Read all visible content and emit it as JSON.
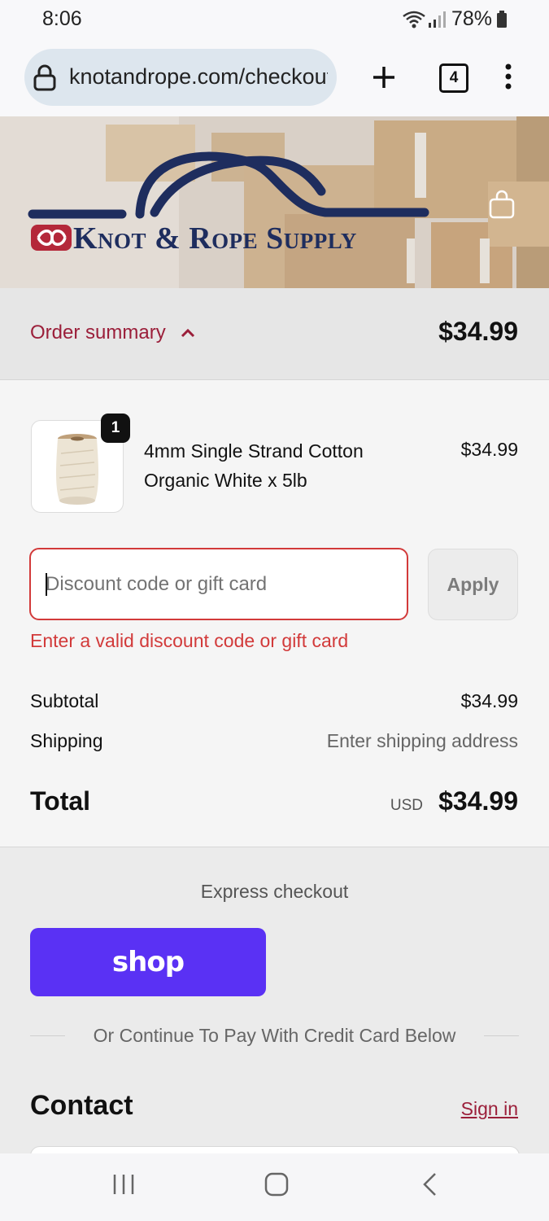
{
  "status_bar": {
    "time": "8:06",
    "battery": "78%"
  },
  "browser": {
    "url": "knotandrope.com/checkout",
    "tab_count": "4"
  },
  "brand": {
    "name": "Knot & Rope Supply"
  },
  "order_summary": {
    "label": "Order summary",
    "total": "$34.99"
  },
  "product": {
    "name": "4mm Single Strand Cotton Organic White x 5lb",
    "price": "$34.99",
    "quantity": "1"
  },
  "discount": {
    "placeholder": "Discount code or gift card",
    "value": "",
    "apply_label": "Apply",
    "error": "Enter a valid discount code or gift card"
  },
  "totals": {
    "subtotal_label": "Subtotal",
    "subtotal_value": "$34.99",
    "shipping_label": "Shipping",
    "shipping_value": "Enter shipping address",
    "total_label": "Total",
    "currency": "USD",
    "total_value": "$34.99"
  },
  "express": {
    "title": "Express checkout",
    "shop_label": "shop",
    "divider_text": "Or Continue To Pay With Credit Card Below"
  },
  "contact": {
    "title": "Contact",
    "sign_in": "Sign in"
  },
  "colors": {
    "accent": "#9b1f3a",
    "error": "#d23a3a",
    "shop": "#5a31f4",
    "brand_navy": "#1e2d5e"
  }
}
